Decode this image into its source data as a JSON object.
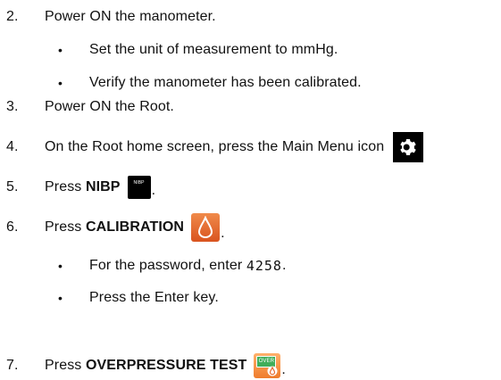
{
  "steps": [
    {
      "number": "2.",
      "text": "Power ON the manometer."
    },
    {
      "bullet": "Set the unit of measurement to mmHg."
    },
    {
      "bullet": "Verify the manometer has been calibrated."
    },
    {
      "number": "3.",
      "text": "Power ON the Root."
    },
    {
      "number": "4.",
      "text": "On the Root home screen, press the Main Menu icon",
      "icon": "gear-icon"
    },
    {
      "number": "5.",
      "prefix": "Press ",
      "bold": "NIBP",
      "suffix": ".",
      "icon": "nibp-icon",
      "icon_text": "NIBP"
    },
    {
      "number": "6.",
      "prefix": "Press ",
      "bold": "CALIBRATION",
      "suffix": ".",
      "icon": "calibration-icon"
    },
    {
      "bullet_prefix": "For the password, enter ",
      "code": "4258",
      "bullet_suffix": "."
    },
    {
      "bullet": "Press the Enter key."
    },
    {
      "number": "7.",
      "prefix": "Press ",
      "bold": "OVERPRESSURE TEST",
      "suffix": ".",
      "icon": "overpressure-test-icon",
      "icon_text": "OVER"
    }
  ],
  "bullet_char": "•",
  "colors": {
    "text": "#111111",
    "orange": "#e86a2e",
    "green": "#3fae5a",
    "black": "#000000"
  }
}
